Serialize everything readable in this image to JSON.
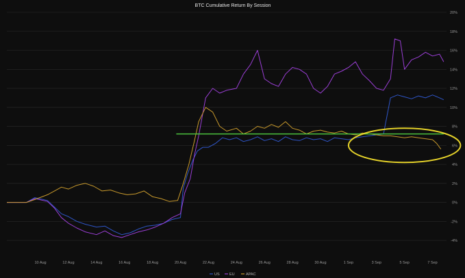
{
  "chart_data": {
    "type": "line",
    "title": "BTC Cumulative Return By Session",
    "xlabel": "",
    "ylabel": "",
    "x_tick_labels": [
      "10 Aug",
      "12 Aug",
      "14 Aug",
      "16 Aug",
      "18 Aug",
      "20 Aug",
      "22 Aug",
      "24 Aug",
      "26 Aug",
      "28 Aug",
      "30 Aug",
      "1 Sep",
      "3 Sep",
      "5 Sep",
      "7 Sep"
    ],
    "x_tick_days": [
      0,
      2,
      4,
      6,
      8,
      10,
      12,
      14,
      16,
      18,
      20,
      22,
      24,
      26,
      28
    ],
    "y_tick_labels": [
      "-4%",
      "-2%",
      "0%",
      "2%",
      "4%",
      "6%",
      "8%",
      "10%",
      "12%",
      "14%",
      "16%",
      "18%",
      "20%"
    ],
    "ylim": [
      -4.5,
      20
    ],
    "xlim": [
      -2.4,
      29
    ],
    "y_axis_position": "right",
    "grid": "horizontal",
    "legend_position": "bottom-center",
    "series": [
      {
        "name": "US",
        "color": "#2f56c9",
        "points": [
          [
            -2.4,
            0
          ],
          [
            -1,
            0
          ],
          [
            -0.4,
            0.5
          ],
          [
            0.5,
            0.2
          ],
          [
            1,
            -0.5
          ],
          [
            1.5,
            -1.2
          ],
          [
            2,
            -1.5
          ],
          [
            2.6,
            -2.0
          ],
          [
            3.2,
            -2.3
          ],
          [
            4,
            -2.6
          ],
          [
            4.6,
            -2.5
          ],
          [
            5.2,
            -3.0
          ],
          [
            5.8,
            -3.4
          ],
          [
            6.4,
            -3.2
          ],
          [
            7,
            -2.8
          ],
          [
            7.6,
            -2.5
          ],
          [
            8.2,
            -2.4
          ],
          [
            8.8,
            -2.2
          ],
          [
            9.4,
            -1.8
          ],
          [
            10,
            -1.6
          ],
          [
            10.2,
            1.5
          ],
          [
            10.5,
            3.0
          ],
          [
            10.9,
            4.5
          ],
          [
            11.2,
            5.4
          ],
          [
            11.6,
            5.8
          ],
          [
            12,
            5.8
          ],
          [
            12.5,
            6.2
          ],
          [
            13,
            6.8
          ],
          [
            13.5,
            6.6
          ],
          [
            14,
            6.8
          ],
          [
            14.5,
            6.4
          ],
          [
            15,
            6.6
          ],
          [
            15.5,
            6.9
          ],
          [
            16,
            6.5
          ],
          [
            16.5,
            6.7
          ],
          [
            17,
            6.4
          ],
          [
            17.5,
            6.9
          ],
          [
            18,
            6.6
          ],
          [
            18.5,
            6.5
          ],
          [
            19,
            6.8
          ],
          [
            19.5,
            6.6
          ],
          [
            20,
            6.7
          ],
          [
            20.5,
            6.4
          ],
          [
            21,
            6.8
          ],
          [
            21.5,
            6.7
          ],
          [
            22,
            6.6
          ],
          [
            22.5,
            6.8
          ],
          [
            23,
            6.9
          ],
          [
            23.5,
            7.0
          ],
          [
            24,
            7.1
          ],
          [
            24.5,
            7.2
          ],
          [
            25,
            11.0
          ],
          [
            25.5,
            11.3
          ],
          [
            26,
            11.1
          ],
          [
            26.5,
            10.9
          ],
          [
            27,
            11.2
          ],
          [
            27.5,
            11.0
          ],
          [
            28,
            11.3
          ],
          [
            28.5,
            11.0
          ],
          [
            28.8,
            10.8
          ]
        ]
      },
      {
        "name": "EU",
        "color": "#9b3fd6",
        "points": [
          [
            -2.4,
            0
          ],
          [
            -1,
            0
          ],
          [
            -0.4,
            0.4
          ],
          [
            0.5,
            0.1
          ],
          [
            1,
            -0.6
          ],
          [
            1.5,
            -1.6
          ],
          [
            2,
            -2.2
          ],
          [
            2.6,
            -2.7
          ],
          [
            3.2,
            -3.1
          ],
          [
            4,
            -3.4
          ],
          [
            4.6,
            -3.0
          ],
          [
            5.2,
            -3.5
          ],
          [
            5.8,
            -3.7
          ],
          [
            6.4,
            -3.4
          ],
          [
            7,
            -3.1
          ],
          [
            7.6,
            -2.9
          ],
          [
            8.2,
            -2.6
          ],
          [
            8.8,
            -2.2
          ],
          [
            9.4,
            -1.6
          ],
          [
            10,
            -1.2
          ],
          [
            10.3,
            1.0
          ],
          [
            10.7,
            2.5
          ],
          [
            11,
            5.0
          ],
          [
            11.3,
            7.0
          ],
          [
            11.8,
            11.0
          ],
          [
            12.3,
            12.0
          ],
          [
            12.8,
            11.5
          ],
          [
            13.3,
            11.8
          ],
          [
            14,
            12.0
          ],
          [
            14.5,
            13.5
          ],
          [
            15,
            14.5
          ],
          [
            15.5,
            16.0
          ],
          [
            16,
            13.0
          ],
          [
            16.5,
            12.5
          ],
          [
            17,
            12.2
          ],
          [
            17.5,
            13.5
          ],
          [
            18,
            14.2
          ],
          [
            18.5,
            14.0
          ],
          [
            19,
            13.5
          ],
          [
            19.5,
            12.0
          ],
          [
            20,
            11.5
          ],
          [
            20.5,
            12.2
          ],
          [
            21,
            13.5
          ],
          [
            21.5,
            13.8
          ],
          [
            22,
            14.2
          ],
          [
            22.5,
            14.8
          ],
          [
            23,
            13.5
          ],
          [
            23.5,
            12.8
          ],
          [
            24,
            12.0
          ],
          [
            24.5,
            11.8
          ],
          [
            25,
            13.0
          ],
          [
            25.3,
            17.2
          ],
          [
            25.7,
            17.0
          ],
          [
            26,
            14.0
          ],
          [
            26.5,
            15.0
          ],
          [
            27,
            15.3
          ],
          [
            27.5,
            15.8
          ],
          [
            28,
            15.4
          ],
          [
            28.5,
            15.6
          ],
          [
            28.8,
            14.8
          ]
        ]
      },
      {
        "name": "APAC",
        "color": "#c99a2c",
        "points": [
          [
            -2.4,
            0
          ],
          [
            -1,
            0
          ],
          [
            -0.4,
            0.3
          ],
          [
            0.5,
            0.8
          ],
          [
            1,
            1.2
          ],
          [
            1.5,
            1.6
          ],
          [
            2,
            1.4
          ],
          [
            2.6,
            1.8
          ],
          [
            3.2,
            2.0
          ],
          [
            3.8,
            1.7
          ],
          [
            4.4,
            1.2
          ],
          [
            5,
            1.3
          ],
          [
            5.6,
            1.0
          ],
          [
            6.2,
            0.8
          ],
          [
            6.8,
            0.9
          ],
          [
            7.4,
            1.2
          ],
          [
            8,
            0.6
          ],
          [
            8.6,
            0.4
          ],
          [
            9.2,
            0.1
          ],
          [
            9.8,
            0.2
          ],
          [
            10.2,
            2.0
          ],
          [
            10.6,
            4.0
          ],
          [
            11,
            6.5
          ],
          [
            11.3,
            8.5
          ],
          [
            11.8,
            10.0
          ],
          [
            12.3,
            9.5
          ],
          [
            12.8,
            8.0
          ],
          [
            13.3,
            7.5
          ],
          [
            14,
            7.8
          ],
          [
            14.5,
            7.2
          ],
          [
            15,
            7.5
          ],
          [
            15.5,
            8.0
          ],
          [
            16,
            7.8
          ],
          [
            16.5,
            8.2
          ],
          [
            17,
            7.9
          ],
          [
            17.5,
            8.5
          ],
          [
            18,
            7.8
          ],
          [
            18.5,
            7.6
          ],
          [
            19,
            7.2
          ],
          [
            19.5,
            7.5
          ],
          [
            20,
            7.6
          ],
          [
            20.5,
            7.4
          ],
          [
            21,
            7.3
          ],
          [
            21.5,
            7.5
          ],
          [
            22,
            7.2
          ],
          [
            22.5,
            7.1
          ],
          [
            23,
            7.3
          ],
          [
            23.5,
            7.2
          ],
          [
            24,
            7.1
          ],
          [
            24.5,
            7.0
          ],
          [
            25,
            7.0
          ],
          [
            25.5,
            6.9
          ],
          [
            26,
            6.8
          ],
          [
            26.5,
            6.9
          ],
          [
            27,
            6.8
          ],
          [
            27.5,
            6.7
          ],
          [
            28,
            6.6
          ],
          [
            28.3,
            6.2
          ],
          [
            28.6,
            5.6
          ]
        ]
      }
    ],
    "annotations": [
      {
        "type": "horizontal_line",
        "color": "#4bc23d",
        "y": 7.2,
        "x_from": 9.7,
        "x_to": 28.8
      },
      {
        "type": "ellipse",
        "color": "#e6d32a",
        "cx_day": 26.0,
        "cy": 6.0,
        "rx_days": 4.0,
        "ry": 1.8
      }
    ]
  }
}
